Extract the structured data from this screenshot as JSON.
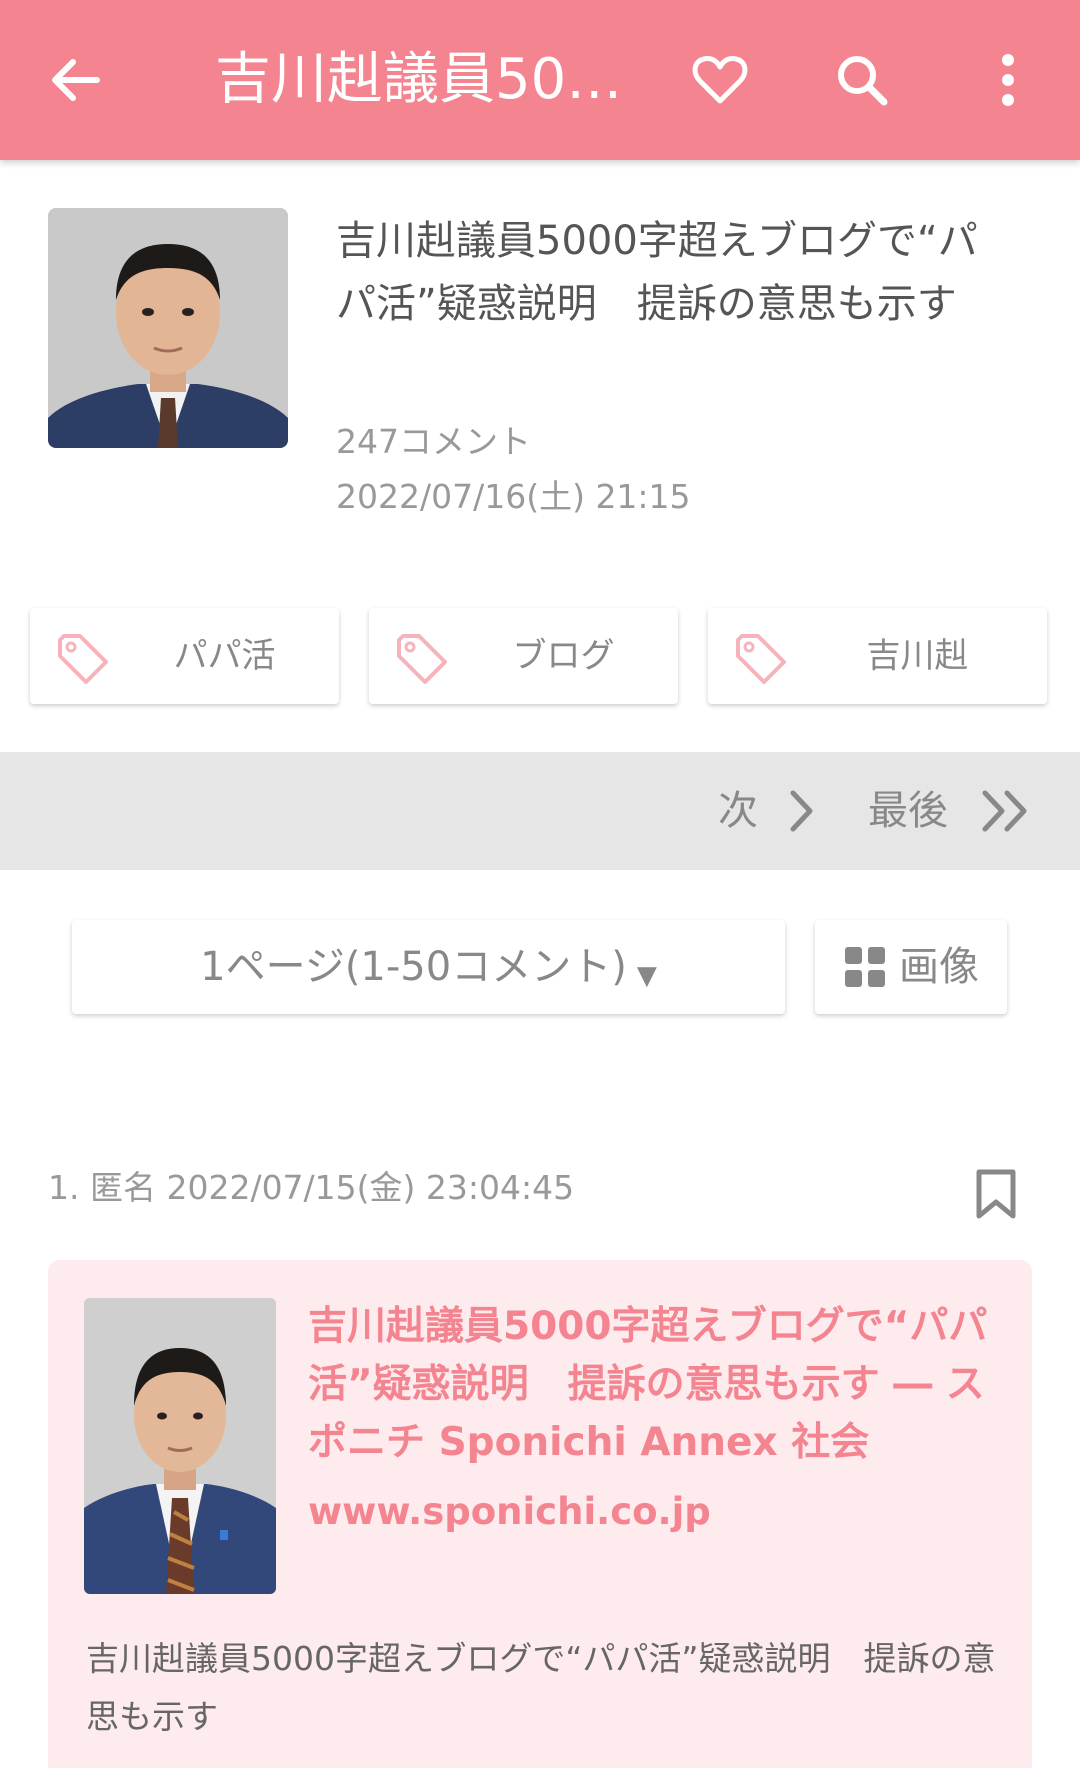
{
  "appbar": {
    "title": "吉川赳議員50…",
    "icons": [
      "back-arrow-icon",
      "heart-icon",
      "search-icon",
      "more-vert-icon"
    ]
  },
  "article": {
    "title": "吉川赳議員5000字超えブログで“パパ活”疑惑説明　提訴の意思も示す",
    "comment_count": "247コメント",
    "datetime": "2022/07/16(土) 21:15"
  },
  "tags": [
    {
      "label": "パパ活"
    },
    {
      "label": "ブログ"
    },
    {
      "label": "吉川赳"
    }
  ],
  "pager": {
    "next_label": "次",
    "last_label": "最後"
  },
  "page_select": {
    "selected": "1ページ(1-50コメント)",
    "caret": "▼"
  },
  "image_button": {
    "label": "画像"
  },
  "comments": [
    {
      "header": "1. 匿名 2022/07/15(金) 23:04:45",
      "link_card": {
        "title": "吉川赳議員5000字超えブログで“パパ活”疑惑説明　提訴の意思も示す ― スポニチ Sponichi Annex 社会",
        "url": "www.sponichi.co.jp"
      },
      "body": "吉川赳議員5000字超えブログで“パパ活”疑惑説明　提訴の意思も示す"
    }
  ],
  "colors": {
    "accent": "#f4848f",
    "card_bg": "#fdebee",
    "pager_bg": "#e6e6e6"
  }
}
